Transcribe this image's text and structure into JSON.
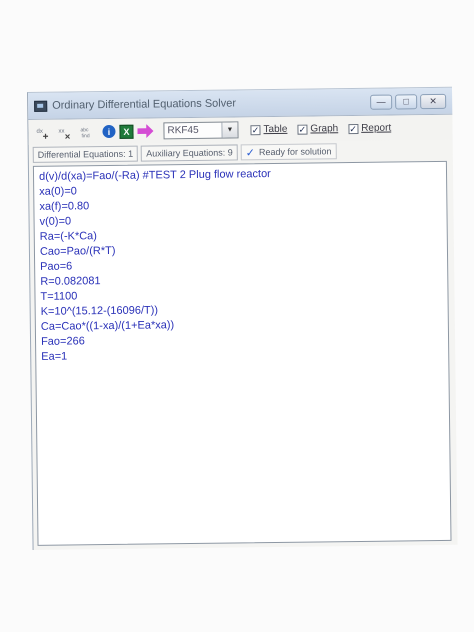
{
  "window": {
    "title": "Ordinary Differential Equations Solver"
  },
  "toolbar": {
    "icon_add_label": "",
    "icon_delete_label": "",
    "icon_find_label": "",
    "solver_method": "RKF45",
    "table_label": "Table",
    "graph_label": "Graph",
    "report_label": "Report",
    "table_checked": true,
    "graph_checked": true,
    "report_checked": true
  },
  "status": {
    "differential_equations": "Differential Equations: 1",
    "auxiliary_equations": "Auxiliary Equations: 9",
    "ready_text": "Ready for solution"
  },
  "editor": {
    "lines": [
      "d(v)/d(xa)=Fao/(-Ra) #TEST 2 Plug flow reactor",
      "xa(0)=0",
      "xa(f)=0.80",
      "v(0)=0",
      "Ra=(-K*Ca)",
      "Cao=Pao/(R*T)",
      "Pao=6",
      "R=0.082081",
      "T=1100",
      "K=10^(15.12-(16096/T))",
      "Ca=Cao*((1-xa)/(1+Ea*xa))",
      "Fao=266",
      "Ea=1"
    ]
  },
  "colors": {
    "code_text": "#2a31b8",
    "titlebar": "#c5d3e6",
    "accent_arrow": "#d44cd4",
    "info_icon": "#2163c4",
    "excel_icon": "#1f7a3a"
  }
}
